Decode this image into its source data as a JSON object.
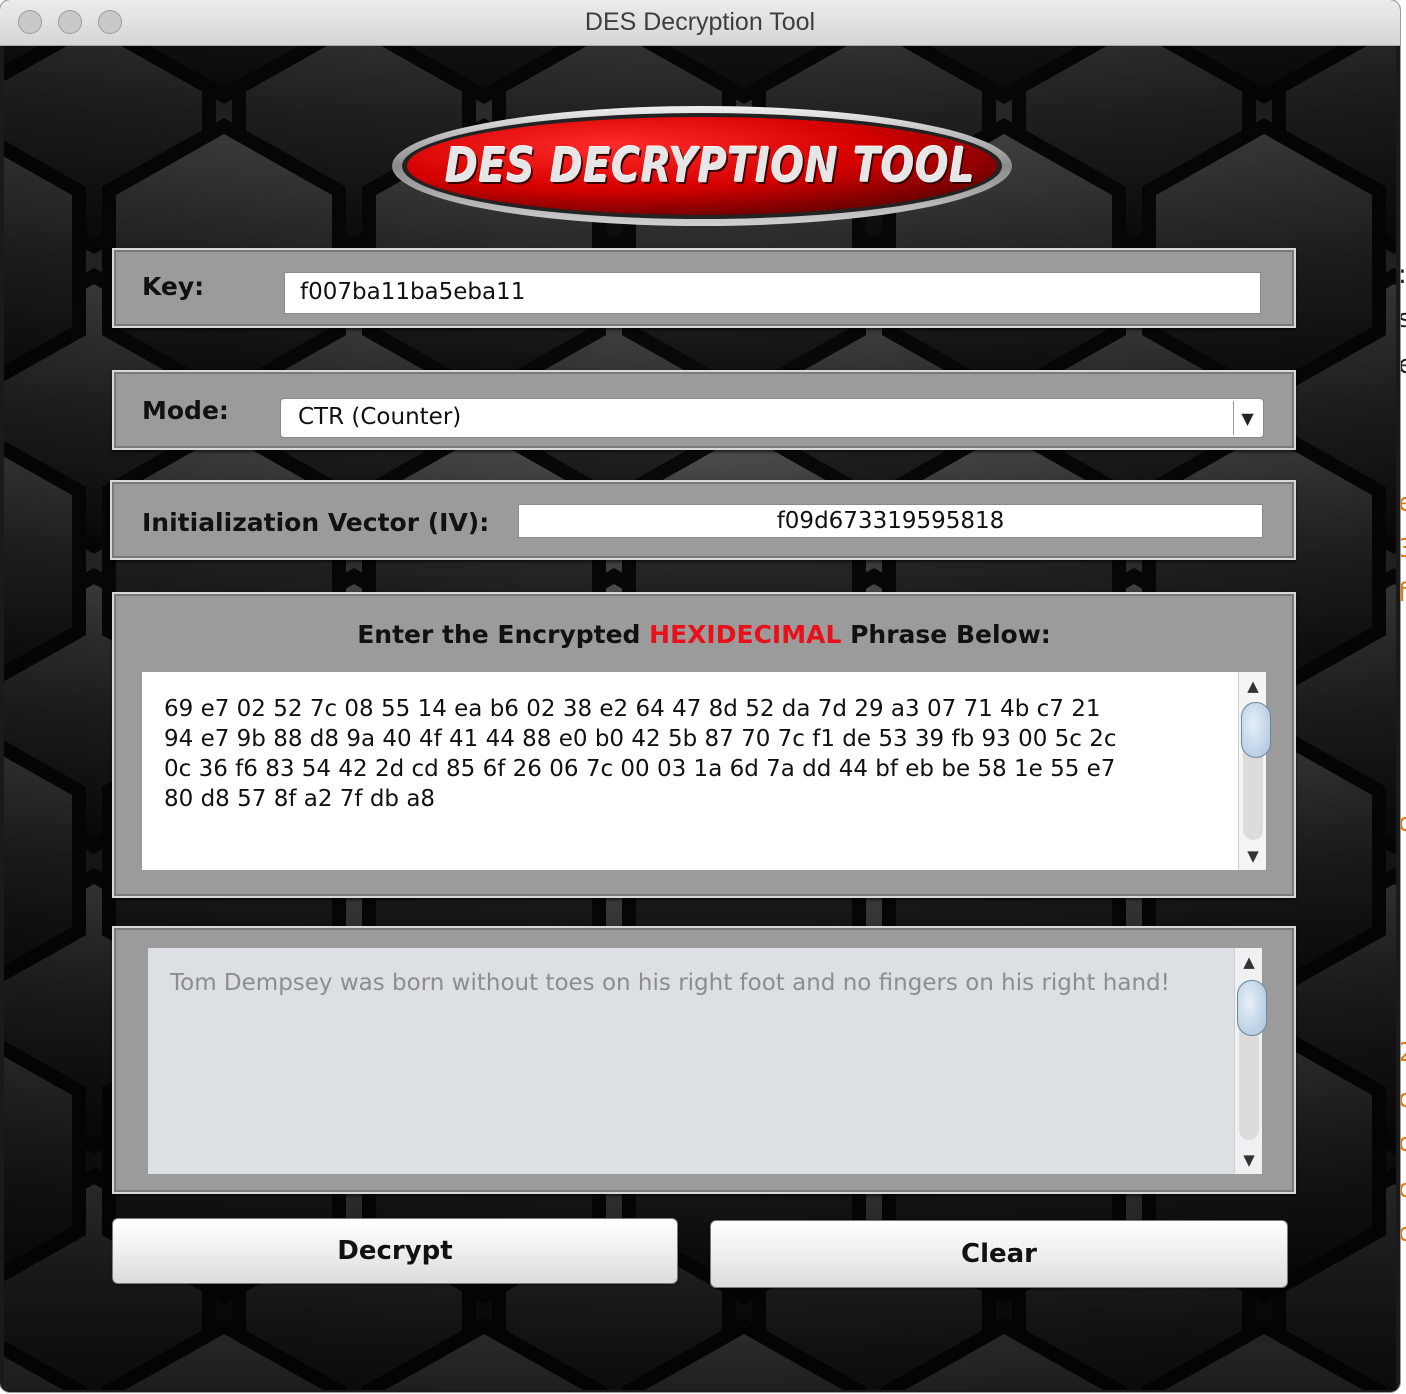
{
  "window": {
    "title": "DES Decryption Tool"
  },
  "logo": {
    "text": "DES DECRYPTION TOOL"
  },
  "key": {
    "label": "Key:",
    "value": "f007ba11ba5eba11"
  },
  "mode": {
    "label": "Mode:",
    "selected": "CTR (Counter)"
  },
  "iv": {
    "label": "Initialization Vector (IV):",
    "value": "f09d673319595818"
  },
  "cipher": {
    "heading_prefix": "Enter the Encrypted ",
    "heading_emphasis": "HEXIDECIMAL",
    "heading_suffix": " Phrase Below:",
    "text": "69 e7 02 52 7c 08 55 14 ea b6 02 38 e2 64 47 8d 52 da 7d 29 a3 07 71 4b c7 21\n94 e7 9b 88 d8 9a 40 4f 41 44 88 e0 b0 42 5b 87 70 7c f1 de 53 39 fb 93 00 5c 2c\n0c 36 f6 83 54 42 2d cd 85 6f 26 06 7c 00 03 1a 6d 7a dd 44 bf eb be 58 1e 55 e7\n80 d8 57 8f a2 7f db a8"
  },
  "output": {
    "text": "Tom Dempsey was born without toes on his right foot and no fingers on his right hand!"
  },
  "buttons": {
    "decrypt": "Decrypt",
    "clear": "Clear"
  },
  "colors": {
    "emphasis": "#e8111a",
    "logo_red": "#d40000",
    "panel": "#9b9b9b"
  },
  "icons": {
    "dropdown": "chevron-down-icon",
    "scroll_up": "arrow-up-icon",
    "scroll_down": "arrow-down-icon"
  }
}
